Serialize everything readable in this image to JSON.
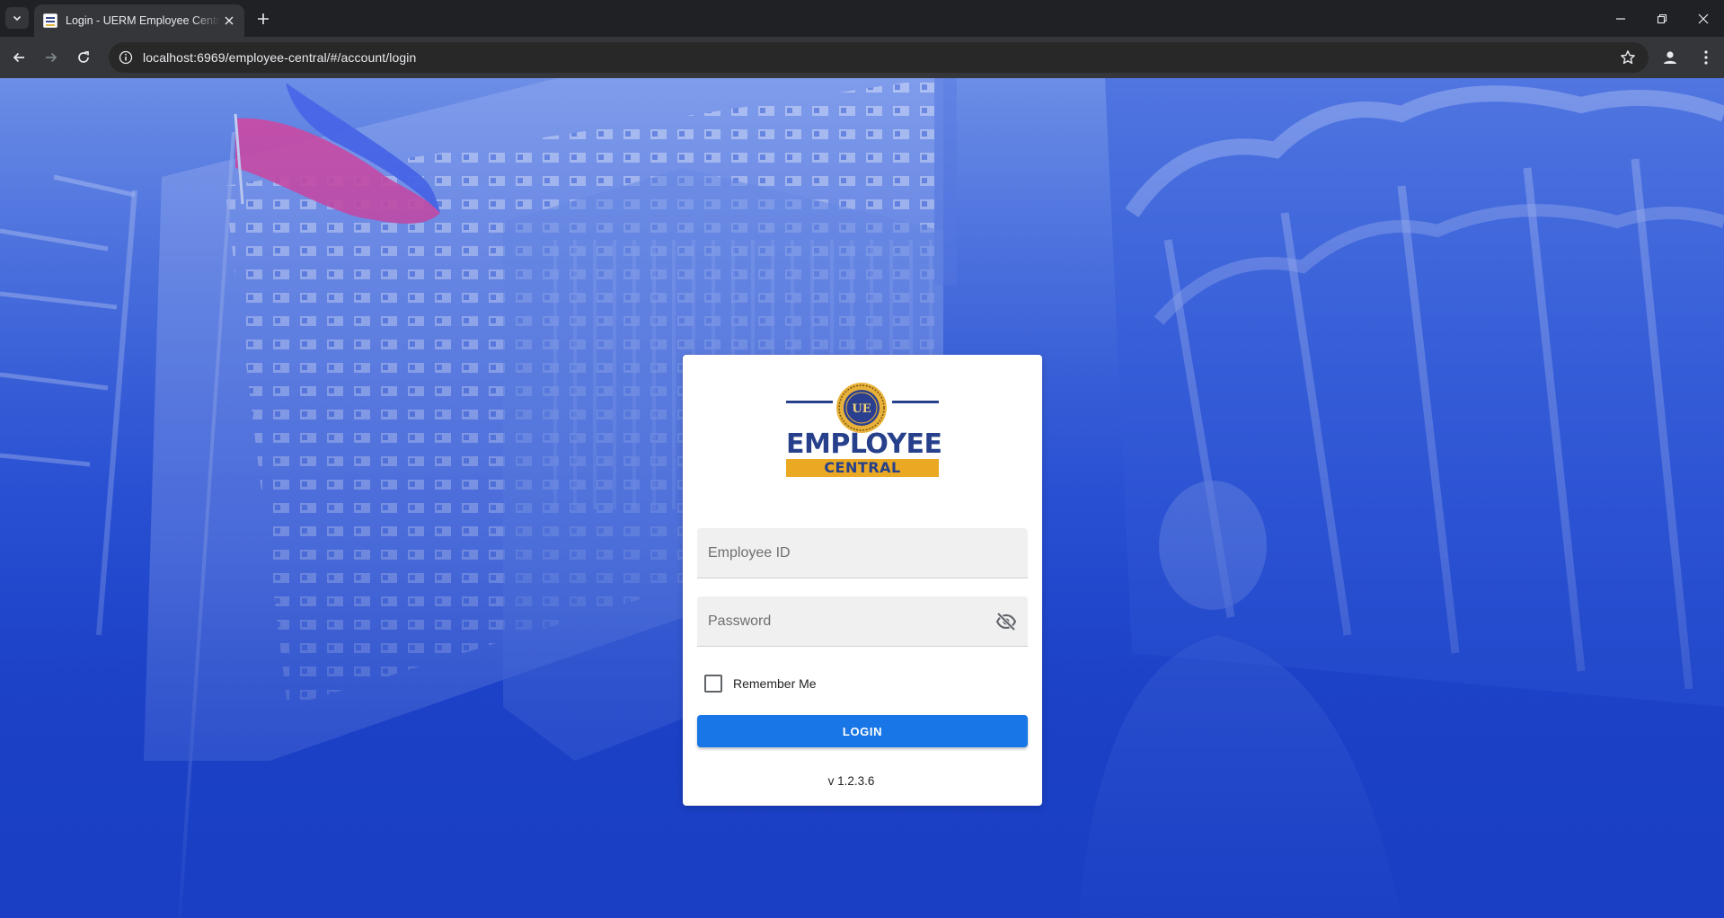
{
  "browser": {
    "tab_title": "Login - UERM Employee Central",
    "url": "localhost:6969/employee-central/#/account/login",
    "icons": {
      "tab_search": "chevron-down-icon",
      "close_tab": "close-icon",
      "new_tab": "plus-icon",
      "back": "arrow-left-icon",
      "forward": "arrow-right-icon",
      "reload": "reload-icon",
      "site_info": "info-icon",
      "bookmark": "star-icon",
      "profile": "profile-icon",
      "menu": "kebab-menu-icon",
      "minimize": "minimize-icon",
      "restore": "restore-icon",
      "close_window": "close-icon"
    }
  },
  "login": {
    "logo": {
      "seal_letters": "UE",
      "word_top": "EMPLOYEE",
      "word_band": "CENTRAL"
    },
    "employee_id_placeholder": "Employee ID",
    "employee_id_value": "",
    "password_placeholder": "Password",
    "password_value": "",
    "password_toggle_icon": "eye-off-icon",
    "remember_label": "Remember Me",
    "remember_checked": false,
    "login_button": "LOGIN",
    "version": "v 1.2.3.6"
  },
  "colors": {
    "brand_navy": "#27408b",
    "brand_gold": "#eaa823",
    "primary_button": "#1976e6",
    "background_blue": "#2f57d8"
  }
}
